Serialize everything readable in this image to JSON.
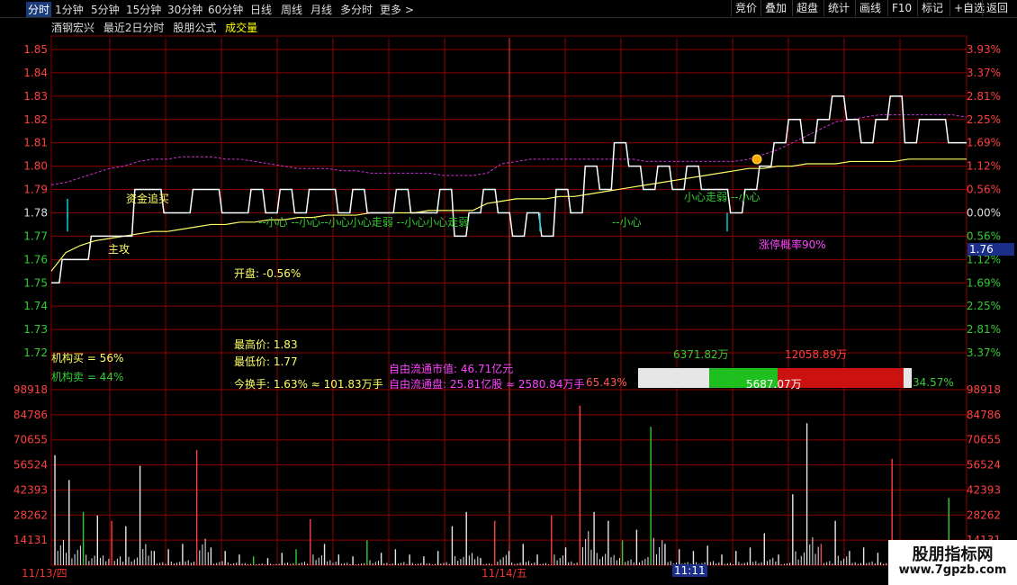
{
  "toolbar": {
    "left": [
      "分时",
      "1分钟",
      "5分钟",
      "15分钟",
      "30分钟",
      "60分钟",
      "日线",
      "周线",
      "月线",
      "多分时",
      "更多 >"
    ],
    "right": [
      "竞价",
      "叠加",
      "超盘",
      "统计",
      "画线",
      "F10",
      "标记",
      "+自选",
      "返回"
    ],
    "active_index": 0
  },
  "header": {
    "stock": "酒钢宏兴",
    "period": "最近2日分时",
    "formula": "股朋公式",
    "indicator": "成交量"
  },
  "colors": {
    "up": "#ff4040",
    "down": "#33cc33",
    "price_line": "#ffffff",
    "avg_line": "#ffff66",
    "ref_line": "#cc33cc",
    "grid": "#8b0000",
    "cyan": "#00cccc"
  },
  "annotations": {
    "zhugong": "主攻",
    "zijin": "资金追买",
    "xiaoxin_row": "--小心    --小心--小心小心走弱    --小心小心走弱",
    "xiaoxin_single": "--小心",
    "zouruo_right": "小心走弱  --小心",
    "limit_prob": "涨停概率90%",
    "open": "开盘: -0.56%",
    "inst_buy": "机构买 = 56%",
    "inst_sell": "机构卖 = 44%",
    "high": "最高价: 1.83",
    "low": "最低价: 1.77",
    "turnover": "今换手: 1.63% ≈ 101.83万手",
    "float_value": "自由流通市值: 46.71亿元",
    "float_shares": "自由流通盘: 25.81亿股 ≈ 2580.84万手",
    "float_pct": "65.43%",
    "bar_left_value": "6371.82万",
    "bar_right_value": "12058.89万",
    "bar_mid_value": "5687.07万",
    "bar_right_pct": "34.57%"
  },
  "bar_segments": {
    "white": 0.26,
    "green": 0.25,
    "red": 0.46,
    "end_white": 0.03
  },
  "dates": {
    "day1": "11/13/四",
    "day2": "11/14/五",
    "cursor_time": "11:11"
  },
  "current_price_label": "1.76",
  "brand": {
    "name": "股朋指标网",
    "url": "www.7gpzb.com"
  },
  "chart_data": {
    "type": "line",
    "price_axis": {
      "ticks": [
        "1.85",
        "1.84",
        "1.83",
        "1.82",
        "1.81",
        "1.80",
        "1.79",
        "1.78",
        "1.77",
        "1.76",
        "1.75",
        "1.74",
        "1.73",
        "1.72"
      ],
      "right_ticks": [
        "3.93%",
        "3.37%",
        "2.81%",
        "2.25%",
        "1.69%",
        "1.12%",
        "0.56%",
        "0.00%",
        "0.56%",
        "1.12%",
        "1.69%",
        "2.25%",
        "2.81%",
        "3.37%"
      ],
      "ylim": [
        1.715,
        1.855
      ],
      "ref_price": 1.78
    },
    "volume_axis": {
      "ticks": [
        "98918",
        "84786",
        "70655",
        "56524",
        "42393",
        "28262",
        "14131"
      ],
      "ylim": [
        0,
        98918
      ]
    },
    "price_series": [
      1.75,
      1.76,
      1.76,
      1.77,
      1.77,
      1.77,
      1.79,
      1.79,
      1.78,
      1.78,
      1.79,
      1.79,
      1.78,
      1.78,
      1.79,
      1.78,
      1.79,
      1.78,
      1.79,
      1.79,
      1.78,
      1.79,
      1.78,
      1.78,
      1.79,
      1.78,
      1.78,
      1.79,
      1.77,
      1.78,
      1.79,
      1.78,
      1.77,
      1.78,
      1.77,
      1.79,
      1.78,
      1.8,
      1.79,
      1.81,
      1.8,
      1.79,
      1.8,
      1.79,
      1.8,
      1.79,
      1.79,
      1.78,
      1.79,
      1.8,
      1.81,
      1.82,
      1.81,
      1.82,
      1.83,
      1.82,
      1.81,
      1.82,
      1.83,
      1.81,
      1.82,
      1.82,
      1.81,
      1.81
    ],
    "avg_series": [
      1.755,
      1.763,
      1.766,
      1.768,
      1.769,
      1.77,
      1.771,
      1.772,
      1.772,
      1.773,
      1.774,
      1.775,
      1.775,
      1.776,
      1.776,
      1.777,
      1.777,
      1.778,
      1.778,
      1.779,
      1.779,
      1.779,
      1.78,
      1.78,
      1.78,
      1.78,
      1.781,
      1.781,
      1.781,
      1.781,
      1.784,
      1.785,
      1.786,
      1.786,
      1.786,
      1.787,
      1.787,
      1.788,
      1.789,
      1.79,
      1.791,
      1.792,
      1.793,
      1.794,
      1.795,
      1.796,
      1.797,
      1.798,
      1.799,
      1.799,
      1.8,
      1.8,
      1.801,
      1.801,
      1.801,
      1.802,
      1.802,
      1.802,
      1.802,
      1.803,
      1.803,
      1.803,
      1.803,
      1.803
    ],
    "ref_series": [
      1.792,
      1.793,
      1.795,
      1.797,
      1.799,
      1.8,
      1.802,
      1.803,
      1.803,
      1.804,
      1.804,
      1.804,
      1.803,
      1.803,
      1.802,
      1.801,
      1.8,
      1.799,
      1.799,
      1.799,
      1.798,
      1.798,
      1.797,
      1.797,
      1.797,
      1.797,
      1.797,
      1.796,
      1.796,
      1.796,
      1.797,
      1.801,
      1.802,
      1.803,
      1.803,
      1.803,
      1.803,
      1.803,
      1.803,
      1.803,
      1.803,
      1.802,
      1.802,
      1.802,
      1.802,
      1.802,
      1.802,
      1.802,
      1.803,
      1.805,
      1.807,
      1.81,
      1.813,
      1.816,
      1.819,
      1.82,
      1.821,
      1.822,
      1.822,
      1.822,
      1.822,
      1.822,
      1.822,
      1.821
    ],
    "volume_series": [
      62000,
      48000,
      30000,
      28000,
      25000,
      22000,
      56000,
      8000,
      9000,
      12000,
      65000,
      10000,
      8000,
      6000,
      5000,
      4000,
      7000,
      9000,
      26000,
      12000,
      6000,
      5000,
      14000,
      7000,
      9000,
      6000,
      5000,
      8000,
      22000,
      30000,
      4000,
      25000,
      8000,
      12000,
      6000,
      28000,
      10000,
      90000,
      30000,
      25000,
      14000,
      20000,
      78000,
      12000,
      9000,
      8000,
      11000,
      6000,
      8000,
      10000,
      18000,
      6000,
      40000,
      80000,
      12000,
      25000,
      8000,
      10000,
      7000,
      60000,
      9000,
      12000,
      10000,
      38000
    ],
    "volume_colors": [
      "w",
      "w",
      "g",
      "w",
      "r",
      "w",
      "w",
      "w",
      "w",
      "w",
      "r",
      "w",
      "w",
      "w",
      "g",
      "w",
      "w",
      "g",
      "r",
      "w",
      "w",
      "w",
      "g",
      "w",
      "w",
      "w",
      "w",
      "w",
      "w",
      "w",
      "w",
      "r",
      "w",
      "w",
      "w",
      "r",
      "w",
      "r",
      "w",
      "w",
      "g",
      "w",
      "g",
      "w",
      "w",
      "w",
      "w",
      "w",
      "w",
      "w",
      "w",
      "w",
      "w",
      "w",
      "r",
      "w",
      "w",
      "w",
      "w",
      "r",
      "w",
      "w",
      "w",
      "g"
    ]
  }
}
